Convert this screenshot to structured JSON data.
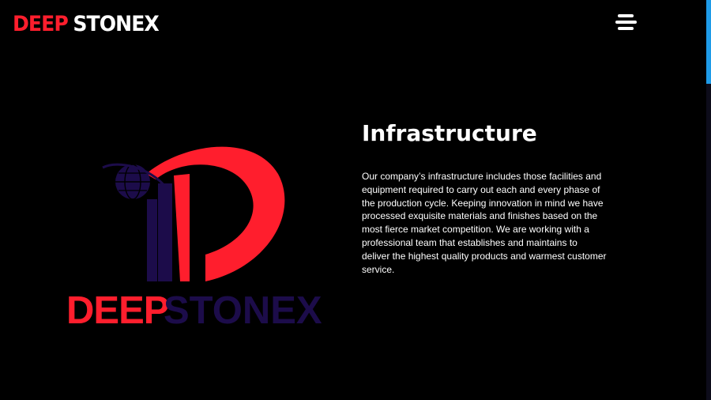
{
  "header": {
    "logo_word1": "DEEP",
    "logo_word2": "STONEX",
    "menu_icon": "hamburger-menu-icon"
  },
  "main": {
    "logo": {
      "word1": "DEEP",
      "word2": "STONEX",
      "emblem_icon": "globe-building-d-emblem"
    },
    "title": "Infrastructure",
    "body": "Our company’s infrastructure includes those facilities and equipment required to carry out each and every phase of the production cycle. Keeping innovation in mind we have processed exquisite materials and finishes based on the most fierce market competition. We are working with a professional team that establishes and maintains to deliver the highest quality products and warmest customer service."
  },
  "colors": {
    "background": "#000000",
    "brand_red": "#ff1e2d",
    "brand_navy": "#1c0c4a",
    "text": "#ffffff",
    "scroll_thumb": "#1e9be8"
  }
}
